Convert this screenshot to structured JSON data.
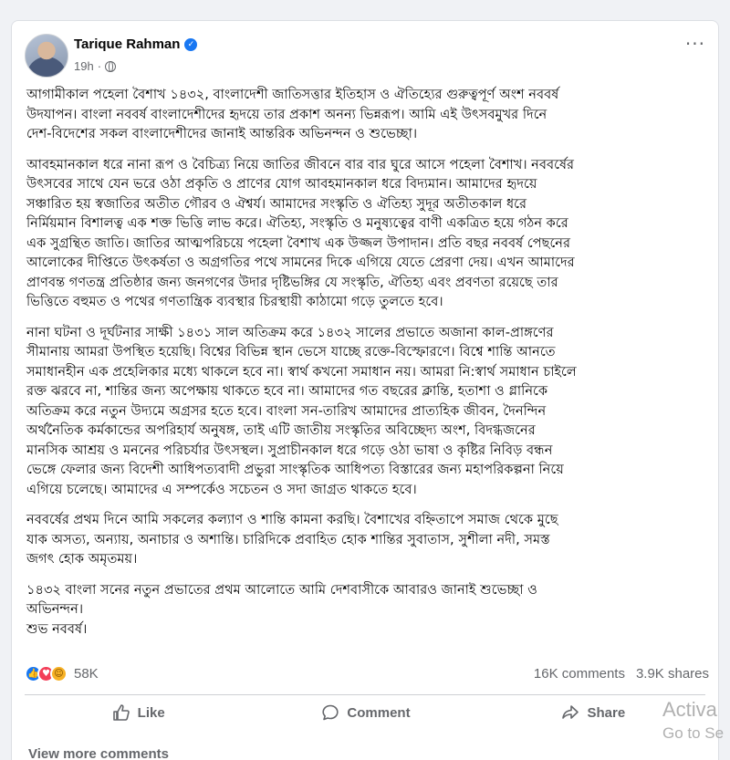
{
  "post": {
    "author": "Tarique Rahman",
    "timestamp": "19h",
    "paragraphs": [
      "আগামীকাল পহেলা বৈশাখ ১৪৩২, বাংলাদেশী জাতিসত্তার ইতিহাস ও ঐতিহ্যের গুরুত্বপূর্ণ অংশ নববর্ষ\nউদযাপন। বাংলা নববর্ষ বাংলাদেশীদের হৃদয়ে তার প্রকাশ অনন্য ভিন্নরূপ। আমি এই উৎসবমুখর দিনে\nদেশ-বিদেশের সকল বাংলাদেশীদের জানাই আন্তরিক অভিনন্দন ও শুভেচ্ছা।",
      "আবহমানকাল ধরে নানা রূপ ও বৈচিত্র্য নিয়ে জাতির জীবনে বার বার ঘুরে আসে পহেলা বৈশাখ। নববর্ষের\nউৎসবের সাথে যেন ভরে ওঠা প্রকৃতি ও প্রাণের যোগ আবহমানকাল ধরে বিদ্যমান। আমাদের হৃদয়ে\nসঞ্চারিত হয় স্বজাতির অতীত গৌরব ও ঐশ্বর্য। আমাদের সংস্কৃতি ও ঐতিহ্য সুদূর অতীতকাল ধরে\nনির্মিয়মান বিশালত্ব এক শক্ত ভিত্তি লাভ করে। ঐতিহ্য, সংস্কৃতি ও মনুষ্যত্বের বাণী একত্রিত হয়ে গঠন করে\nএক সুগ্রন্থিত জাতি। জাতির আত্মপরিচয়ে পহেলা বৈশাখ এক উজ্জল উপাদান। প্রতি বছর নববর্ষ পেছনের\nআলোকের দীপ্তিতে উৎকর্ষতা ও অগ্রগতির পথে সামনের দিকে এগিয়ে যেতে প্রেরণা দেয়। এখন আমাদের\nপ্রাণবন্ত গণতন্ত্র প্রতিষ্ঠার জন্য জনগণের উদার দৃষ্টিভঙ্গির যে সংস্কৃতি, ঐতিহ্য এবং প্রবণতা রয়েছে তার\nভিত্তিতে বহুমত ও পথের গণতান্ত্রিক ব্যবস্থার চিরস্থায়ী কাঠামো গড়ে তুলতে হবে।",
      "নানা ঘটনা ও দূর্ঘটনার সাক্ষী ১৪৩১ সাল অতিক্রম করে ১৪৩২ সালের প্রভাতে অজানা কাল-প্রাঙ্গণের\nসীমানায় আমরা উপস্থিত হয়েছি। বিশ্বের বিভিন্ন স্থান ভেসে যাচ্ছে রক্তে-বিস্ফোরণে। বিশ্বে শান্তি আনতে\nসমাধানহীন এক প্রহেলিকার মধ্যে থাকলে হবে না। স্বার্থ কখনো সমাধান নয়। আমরা নি:স্বার্থ সমাধান চাইলে\nরক্ত ঝরবে না, শান্তির জন্য অপেক্ষায় থাকতে হবে না। আমাদের গত বছরের ক্লান্তি, হতাশা ও গ্লানিকে\nঅতিক্রম করে নতুন উদ্যমে অগ্রসর হতে হবে। বাংলা সন-তারিখ আমাদের প্রাত্যহিক জীবন, দৈনন্দিন\nঅর্থনৈতিক কর্মকান্ডের অপরিহার্য অনুষঙ্গ, তাই এটি জাতীয় সংস্কৃতির অবিচ্ছেদ্য অংশ, বিদগ্ধজনের\nমানসিক আশ্রয় ও মননের পরিচর্যার উৎসস্থল। সুপ্রাচীনকাল ধরে গড়ে ওঠা ভাষা ও কৃষ্টির নিবিড় বন্ধন\nভেঙ্গে ফেলার জন্য বিদেশী আধিপত্যবাদী প্রভুরা সাংস্কৃতিক আধিপত্য বিস্তারের জন্য মহাপরিকল্পনা নিয়ে\nএগিয়ে চলেছে। আমাদের এ সম্পর্কেও সচেতন ও সদা জাগ্রত থাকতে হবে।",
      "নববর্ষের প্রথম দিনে আমি সকলের কল্যাণ ও শান্তি কামনা করছি। বৈশাখের বহ্নিতাপে সমাজ থেকে মুছে\nযাক অসত্য, অন্যায়, অনাচার ও অশান্তি। চারিদিকে প্রবাহিত হোক শান্তির সুবাতাস, সুশীলা নদী, সমস্ত\nজগৎ হোক অমৃতময়।",
      "১৪৩২ বাংলা সনের নতুন প্রভাতের প্রথম আলোতে আমি দেশবাসীকে আবারও জানাই শুভেচ্ছা ও\nঅভিনন্দন।\nশুভ নববর্ষ।"
    ]
  },
  "reactions": {
    "icons": [
      "like-reaction",
      "love-reaction",
      "care-reaction"
    ],
    "count": "58K",
    "comments": "16K comments",
    "shares": "3.9K shares"
  },
  "actions": {
    "like": "Like",
    "comment": "Comment",
    "share": "Share"
  },
  "view_more_comments": "View more comments",
  "watermark": {
    "line1": "Activa",
    "line2": "Go to Se"
  },
  "colors": {
    "verified": "#1877f2",
    "like": "#1877f2",
    "love": "#f33e58",
    "care": "#f7b125",
    "muted_text": "#65676b"
  }
}
